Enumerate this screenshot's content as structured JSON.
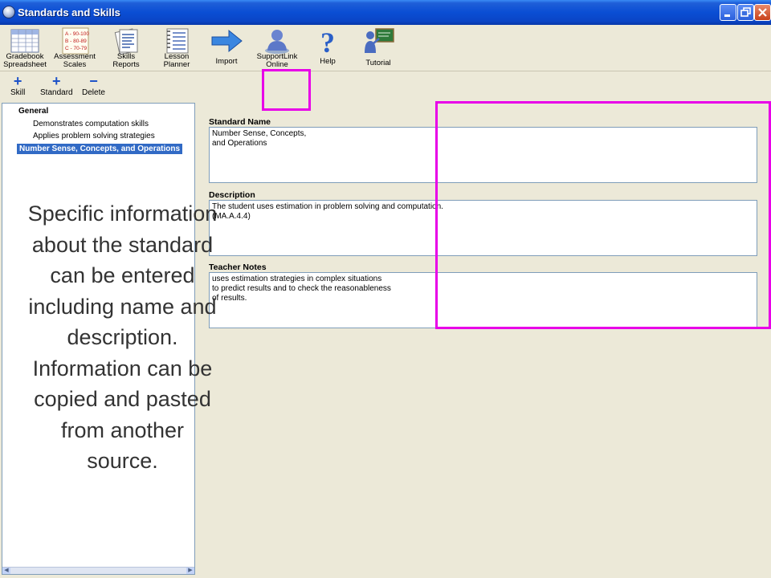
{
  "window": {
    "title": "Standards and Skills"
  },
  "toolbar": {
    "buttons": [
      {
        "label": "Gradebook\nSpreadsheet",
        "icon": "spreadsheet-icon"
      },
      {
        "label": "Assessment\nScales",
        "icon": "grading-scale-icon",
        "scale_lines": [
          "A - 90-100",
          "B - 80-89",
          "C - 70-79"
        ]
      },
      {
        "label": "Skills\nReports",
        "icon": "report-icon"
      },
      {
        "label": "Lesson\nPlanner",
        "icon": "planner-icon"
      },
      {
        "label": "Import",
        "icon": "arrow-right-icon"
      },
      {
        "label": "SupportLink\nOnline",
        "icon": "user-support-icon"
      },
      {
        "label": "Help",
        "icon": "question-mark-icon"
      },
      {
        "label": "Tutorial",
        "icon": "teacher-board-icon"
      }
    ]
  },
  "subtoolbar": {
    "skill": "Skill",
    "standard": "Standard",
    "delete": "Delete"
  },
  "tree": {
    "group": "General",
    "items": [
      "Demonstrates computation skills",
      "Applies problem solving strategies"
    ],
    "selected": "Number Sense, Concepts, and Operations"
  },
  "form": {
    "standard_name_label": "Standard Name",
    "standard_name_value": "Number Sense, Concepts,\nand Operations",
    "description_label": "Description",
    "description_value": "The student uses estimation in problem solving and computation.\n(MA.A.4.4)",
    "notes_label": "Teacher Notes",
    "notes_value": "uses estimation strategies in complex situations\nto predict results and to check the reasonableness\nof results."
  },
  "callout": {
    "text": "Specific information about the standard can be entered including name and description. Information can be copied and pasted from another source."
  },
  "colors": {
    "highlight": "#e800e8",
    "title_bar": "#0a4ed4",
    "selection": "#316ac5"
  }
}
